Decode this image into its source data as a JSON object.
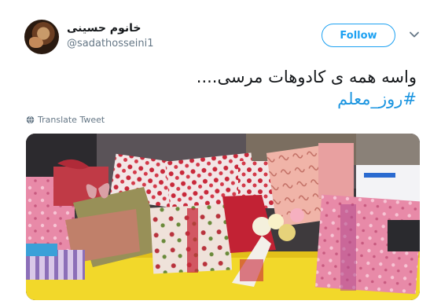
{
  "user": {
    "display_name": "خانوم حسینی",
    "handle": "@sadathosseini1"
  },
  "follow_label": "Follow",
  "tweet": {
    "text": "واسه همه ی کادوهات مرسی....",
    "hashtag": "#روز_معلم"
  },
  "translate_label": "Translate Tweet",
  "icons": {
    "menu": "chevron-down-icon",
    "translate": "globe-icon"
  },
  "colors": {
    "accent": "#1da1f2",
    "hashtag": "#1b95e0",
    "muted": "#657786"
  }
}
